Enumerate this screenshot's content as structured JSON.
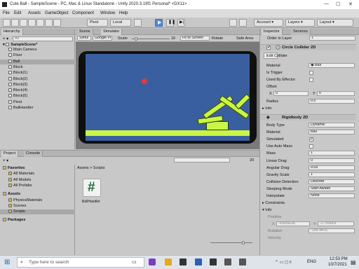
{
  "window": {
    "title": "Cute Ball - SampleScene - PC, Mac & Linux Standalone - Unity 2020.3.19f1 Personal* <DX11>"
  },
  "menu": [
    "File",
    "Edit",
    "Assets",
    "GameObject",
    "Component",
    "Window",
    "Help"
  ],
  "toolbar": {
    "pivot": "Pivot",
    "local": "Local",
    "account": "Account",
    "layers": "Layers",
    "layout": "Layout"
  },
  "hierarchy": {
    "tab": "Hierarchy",
    "search_placeholder": "All",
    "scene": "SampleScene*",
    "items": [
      "Main Camera",
      "Floor",
      "Ball",
      "Block",
      "Block(1)",
      "Block(2)",
      "Block(3)",
      "Block(4)",
      "Block(5)",
      "Pivot",
      "BallHandler"
    ],
    "selected": "Ball"
  },
  "viewtabs": {
    "scene": "Scene",
    "simulator": "Simulator"
  },
  "simbar": {
    "mode": "Simul",
    "device": "Google Pi",
    "scale_label": "Scale",
    "scale_value": "16",
    "fit": "Fit to Screen",
    "rotate": "Rotate",
    "safe": "Safe Area"
  },
  "project": {
    "tab1": "Project",
    "tab2": "Console",
    "count": "20",
    "tree": [
      {
        "label": "Favorites",
        "level": 0,
        "bold": true
      },
      {
        "label": "All Materials",
        "level": 1
      },
      {
        "label": "All Models",
        "level": 1
      },
      {
        "label": "All Prefabs",
        "level": 1
      },
      {
        "label": "Assets",
        "level": 0,
        "bold": true
      },
      {
        "label": "PhysicsMaterials",
        "level": 1
      },
      {
        "label": "Scenes",
        "level": 1
      },
      {
        "label": "Scripts",
        "level": 1,
        "sel": true
      },
      {
        "label": "Packages",
        "level": 0,
        "bold": true
      }
    ],
    "breadcrumb": "Assets > Scripts",
    "asset_label": "BallHandler",
    "asset_glyph": "#"
  },
  "inspector": {
    "tab1": "Inspector",
    "tab2": "Services",
    "order_label": "Order in Layer",
    "order_value": "1",
    "circle": {
      "title": "Circle Collider 2D",
      "edit": "Edit Collider",
      "material": "Material",
      "material_value": "Ball",
      "trigger": "Is Trigger",
      "effector": "Used By Effector",
      "offset": "Offset",
      "x_label": "X",
      "x": "0",
      "y_label": "Y",
      "y": "0",
      "radius": "Radius",
      "radius_value": "0.5",
      "info": "Info"
    },
    "rigid": {
      "title": "Rigidbody 2D",
      "rows": [
        {
          "label": "Body Type",
          "value": "Dynamic"
        },
        {
          "label": "Material",
          "value": "Ball"
        },
        {
          "label": "Simulated",
          "check": true
        },
        {
          "label": "Use Auto Mass",
          "check": false
        },
        {
          "label": "Mass",
          "value": "1"
        },
        {
          "label": "Linear Drag",
          "value": "0"
        },
        {
          "label": "Angular Drag",
          "value": "0.05"
        },
        {
          "label": "Gravity Scale",
          "value": "1"
        },
        {
          "label": "Collision Detection",
          "value": "Discrete"
        },
        {
          "label": "Sleeping Mode",
          "value": "Start Awake"
        },
        {
          "label": "Interpolate",
          "value": "None"
        }
      ],
      "constraints": "Constraints",
      "info": "Info",
      "position": "Position",
      "px_label": "X",
      "px": "-9.839226",
      "py_label": "Y",
      "py": "-2.755001",
      "rotation": "Rotation",
      "rotation_value": "-155.4476",
      "velocity": "Velocity"
    }
  },
  "taskbar": {
    "search_placeholder": "Type here to search",
    "lang": "ENG",
    "time": "12:53 PM",
    "date": "10/7/2021"
  },
  "colors": {
    "sky": "#3a5fa0",
    "ground": "#c9f545",
    "ball": "#e8383b",
    "phone": "#101010"
  }
}
